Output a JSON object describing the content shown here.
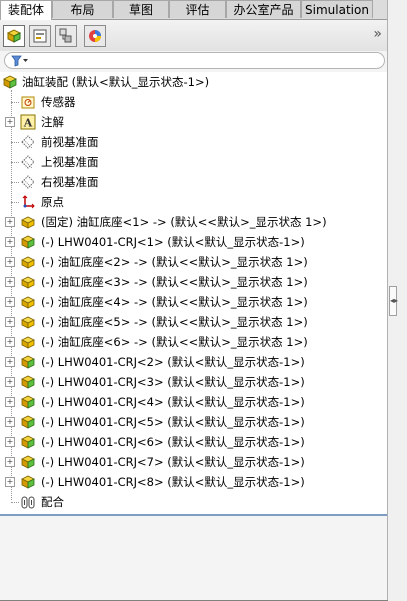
{
  "tabs": [
    "装配体",
    "布局",
    "草图",
    "评估",
    "办公室产品",
    "Simulation"
  ],
  "toolbar": {
    "buttons": [
      {
        "name": "feature-manager-button",
        "icon": "feature-tree-icon"
      },
      {
        "name": "property-manager-button",
        "icon": "property-icon"
      },
      {
        "name": "configuration-manager-button",
        "icon": "configuration-icon"
      },
      {
        "name": "display-manager-button",
        "icon": "display-icon"
      }
    ],
    "more": "»"
  },
  "filter": {
    "icon": "filter-icon",
    "placeholder": ""
  },
  "tree": {
    "root": "油缸装配  (默认<默认_显示状态-1>)",
    "items": [
      {
        "label": "传感器",
        "icon": "sensor-icon",
        "expander": false,
        "indent": 1
      },
      {
        "label": "注解",
        "icon": "annotation-icon",
        "expander": true,
        "indent": 1
      },
      {
        "label": "前视基准面",
        "icon": "plane-icon",
        "expander": false,
        "indent": 1
      },
      {
        "label": "上视基准面",
        "icon": "plane-icon",
        "expander": false,
        "indent": 1
      },
      {
        "label": "右视基准面",
        "icon": "plane-icon",
        "expander": false,
        "indent": 1
      },
      {
        "label": "原点",
        "icon": "origin-icon",
        "expander": false,
        "indent": 1
      },
      {
        "label": "(固定) 油缸底座<1> -> (默认<<默认>_显示状态 1>)",
        "icon": "part-icon",
        "expander": true,
        "indent": 1
      },
      {
        "label": "(-) LHW0401-CRJ<1> (默认<默认_显示状态-1>)",
        "icon": "subassembly-icon",
        "expander": true,
        "indent": 1
      },
      {
        "label": "(-) 油缸底座<2> -> (默认<<默认>_显示状态 1>)",
        "icon": "part-icon",
        "expander": true,
        "indent": 1
      },
      {
        "label": "(-) 油缸底座<3> -> (默认<<默认>_显示状态 1>)",
        "icon": "part-icon",
        "expander": true,
        "indent": 1
      },
      {
        "label": "(-) 油缸底座<4> -> (默认<<默认>_显示状态 1>)",
        "icon": "part-icon",
        "expander": true,
        "indent": 1
      },
      {
        "label": "(-) 油缸底座<5> -> (默认<<默认>_显示状态 1>)",
        "icon": "part-icon",
        "expander": true,
        "indent": 1
      },
      {
        "label": "(-) 油缸底座<6> -> (默认<<默认>_显示状态 1>)",
        "icon": "part-icon",
        "expander": true,
        "indent": 1
      },
      {
        "label": "(-) LHW0401-CRJ<2> (默认<默认_显示状态-1>)",
        "icon": "subassembly-icon",
        "expander": true,
        "indent": 1
      },
      {
        "label": "(-) LHW0401-CRJ<3> (默认<默认_显示状态-1>)",
        "icon": "subassembly-icon",
        "expander": true,
        "indent": 1
      },
      {
        "label": "(-) LHW0401-CRJ<4> (默认<默认_显示状态-1>)",
        "icon": "subassembly-icon",
        "expander": true,
        "indent": 1
      },
      {
        "label": "(-) LHW0401-CRJ<5> (默认<默认_显示状态-1>)",
        "icon": "subassembly-icon",
        "expander": true,
        "indent": 1
      },
      {
        "label": "(-) LHW0401-CRJ<6> (默认<默认_显示状态-1>)",
        "icon": "subassembly-icon",
        "expander": true,
        "indent": 1
      },
      {
        "label": "(-) LHW0401-CRJ<7> (默认<默认_显示状态-1>)",
        "icon": "subassembly-icon",
        "expander": true,
        "indent": 1
      },
      {
        "label": "(-) LHW0401-CRJ<8> (默认<默认_显示状态-1>)",
        "icon": "subassembly-icon",
        "expander": true,
        "indent": 1
      },
      {
        "label": "配合",
        "icon": "mate-icon",
        "expander": false,
        "indent": 1
      }
    ]
  },
  "colors": {
    "selection_line": "#7d9dc2",
    "part_yellow": "#f2c500",
    "part_green": "#5fbf3f"
  }
}
